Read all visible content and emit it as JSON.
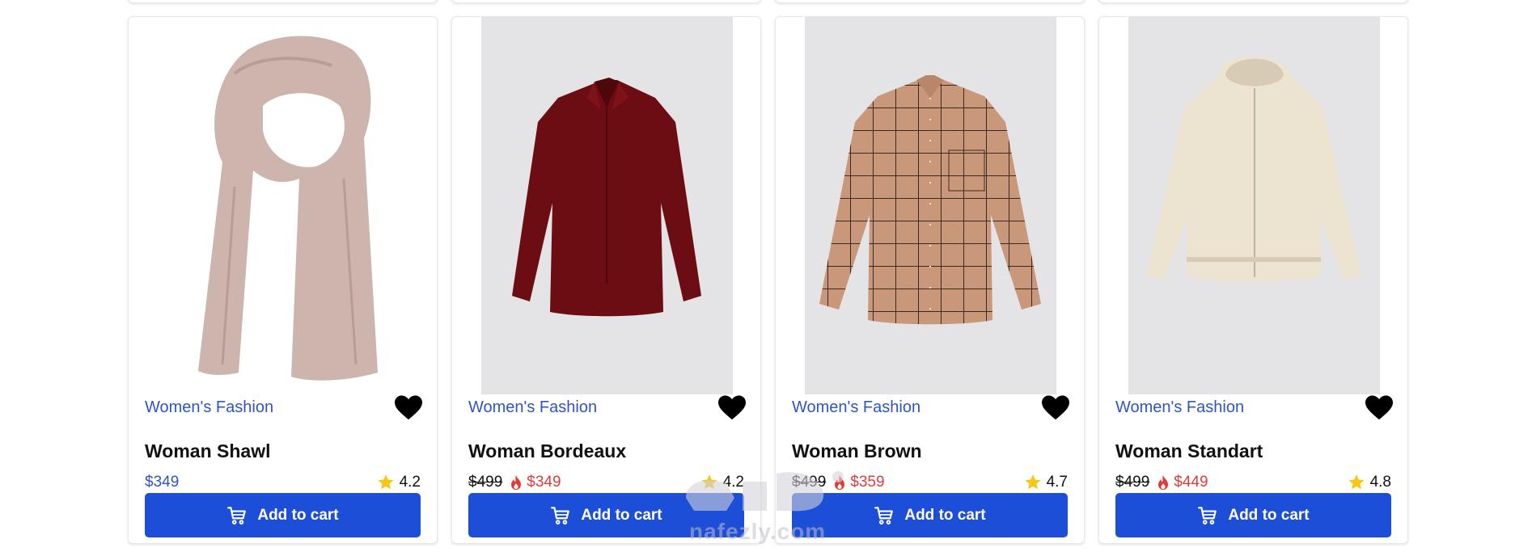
{
  "colors": {
    "accent": "#1d4ed8",
    "category": "#2f55c4",
    "sale_price": "#e03b3b",
    "star": "#f6c619",
    "image_bg": "#e4e4e6"
  },
  "watermark": {
    "logo_icon": "nafezly-logo-icon",
    "url": "nafezly.com"
  },
  "products": [
    {
      "category": "Women's Fashion",
      "name": "Woman Shawl",
      "old_price": "",
      "price": "$349",
      "rating": "4.2",
      "cart_label": "Add to cart",
      "image_icon": "shawl-image",
      "favorite_icon": "heart-icon"
    },
    {
      "category": "Women's Fashion",
      "name": "Woman Bordeaux",
      "old_price": "$499",
      "price": "$349",
      "rating": "4.2",
      "cart_label": "Add to cart",
      "image_icon": "bordeaux-shirt-image",
      "favorite_icon": "heart-icon"
    },
    {
      "category": "Women's Fashion",
      "name": "Woman Brown",
      "old_price": "$499",
      "price": "$359",
      "rating": "4.7",
      "cart_label": "Add to cart",
      "image_icon": "brown-plaid-shirt-image",
      "favorite_icon": "heart-icon"
    },
    {
      "category": "Women's Fashion",
      "name": "Woman Standart",
      "old_price": "$499",
      "price": "$449",
      "rating": "4.8",
      "cart_label": "Add to cart",
      "image_icon": "hoodie-image",
      "favorite_icon": "heart-icon"
    }
  ]
}
